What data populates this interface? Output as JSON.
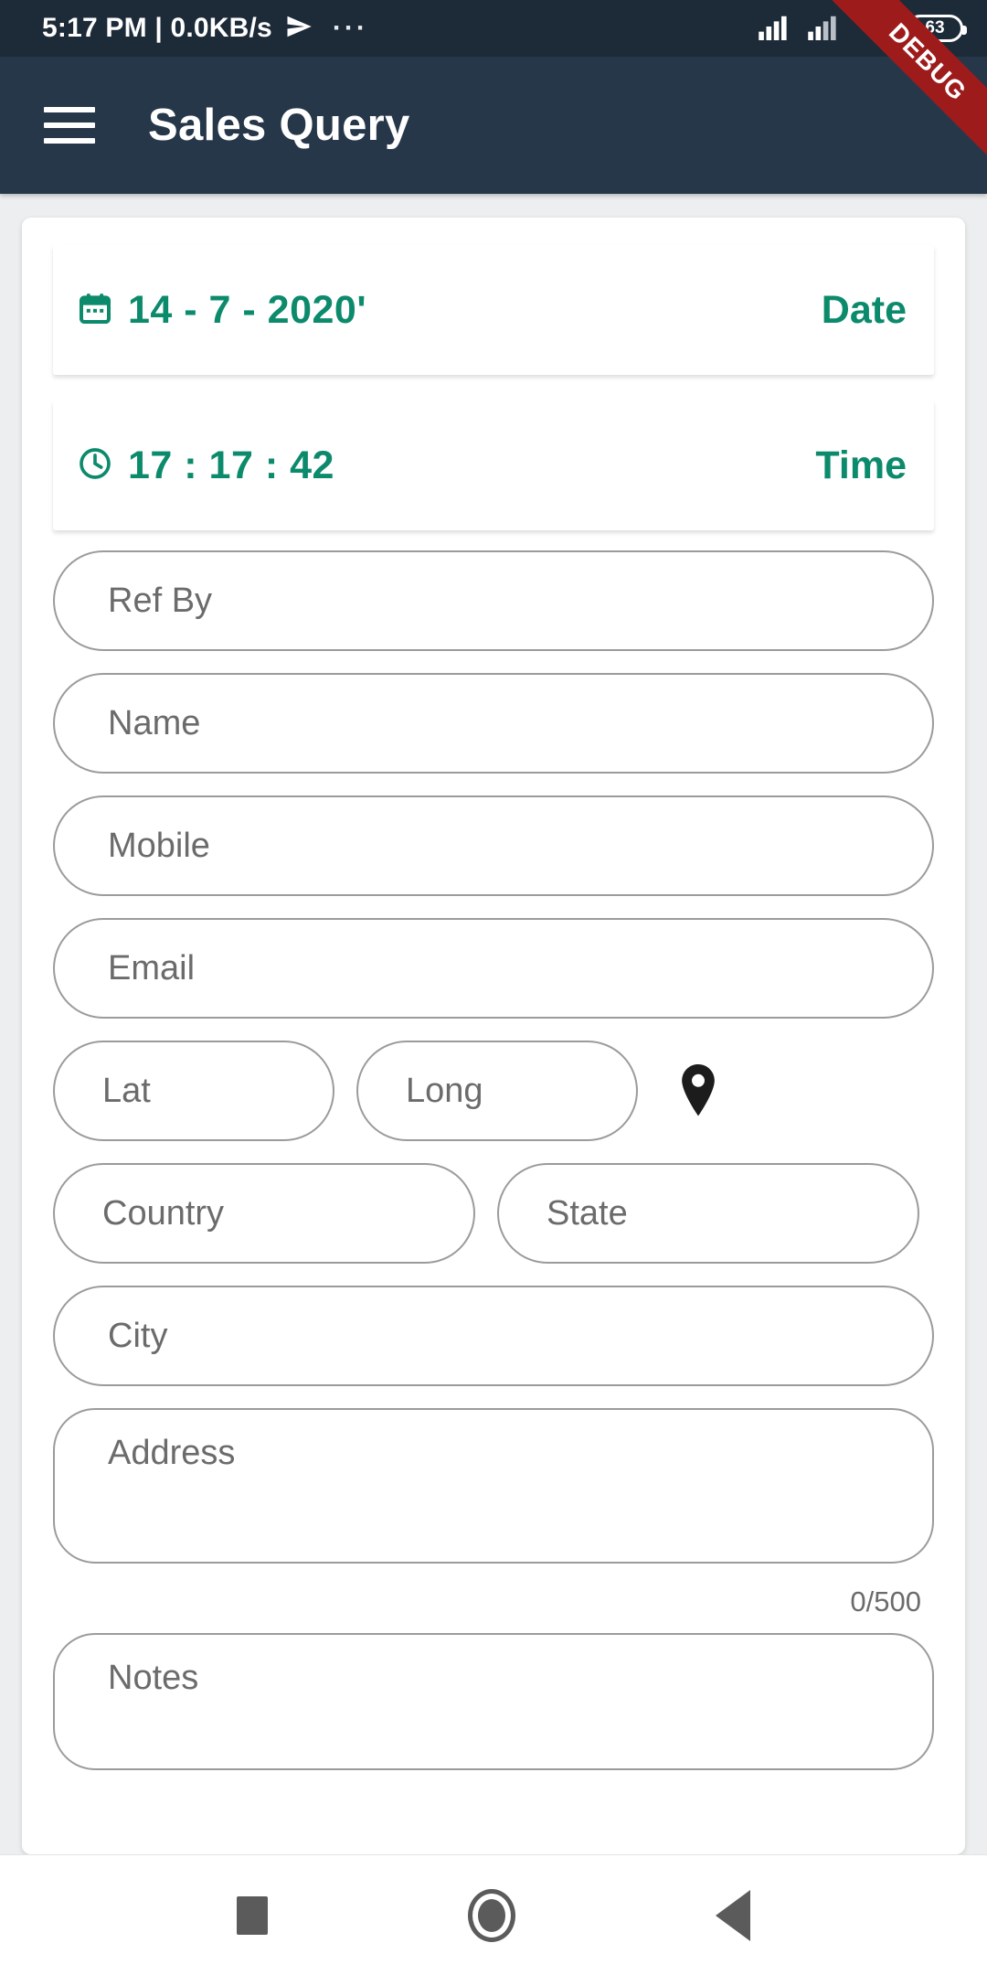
{
  "statusbar": {
    "clock": "5:17 PM | 0.0KB/s",
    "overflow_dots": "···",
    "battery_level": "63",
    "icons": [
      "send-icon",
      "signal-icon",
      "signal-icon",
      "wifi-icon",
      "battery-icon"
    ]
  },
  "debug_banner": {
    "label": "DEBUG",
    "color": "#9e1b1b"
  },
  "appbar": {
    "title": "Sales Query",
    "menu_icon": "hamburger-menu-icon",
    "background": "#27374a"
  },
  "theme": {
    "accent": "#0c8a6c",
    "placeholder": "#6b6b6b",
    "border": "#9b9b9b"
  },
  "form": {
    "date_row": {
      "value": "14 - 7 - 2020'",
      "label": "Date",
      "icon": "calendar-icon"
    },
    "time_row": {
      "value": "17 : 17 : 42",
      "label": "Time",
      "icon": "clock-icon"
    },
    "fields": [
      {
        "name": "ref-by",
        "placeholder": "Ref By",
        "value": ""
      },
      {
        "name": "name",
        "placeholder": "Name",
        "value": ""
      },
      {
        "name": "mobile",
        "placeholder": "Mobile",
        "value": ""
      },
      {
        "name": "email",
        "placeholder": "Email",
        "value": ""
      },
      {
        "name": "lat",
        "placeholder": "Lat",
        "value": ""
      },
      {
        "name": "long",
        "placeholder": "Long",
        "value": ""
      },
      {
        "name": "country",
        "placeholder": "Country",
        "value": ""
      },
      {
        "name": "state",
        "placeholder": "State",
        "value": ""
      },
      {
        "name": "city",
        "placeholder": "City",
        "value": ""
      },
      {
        "name": "address",
        "placeholder": "Address",
        "value": ""
      },
      {
        "name": "notes",
        "placeholder": "Notes",
        "value": ""
      }
    ],
    "location_icon": "map-pin-icon",
    "address_counter": "0/500"
  },
  "navbar": {
    "recents_icon": "square-recents-icon",
    "home_icon": "circle-home-icon",
    "back_icon": "triangle-back-icon"
  }
}
